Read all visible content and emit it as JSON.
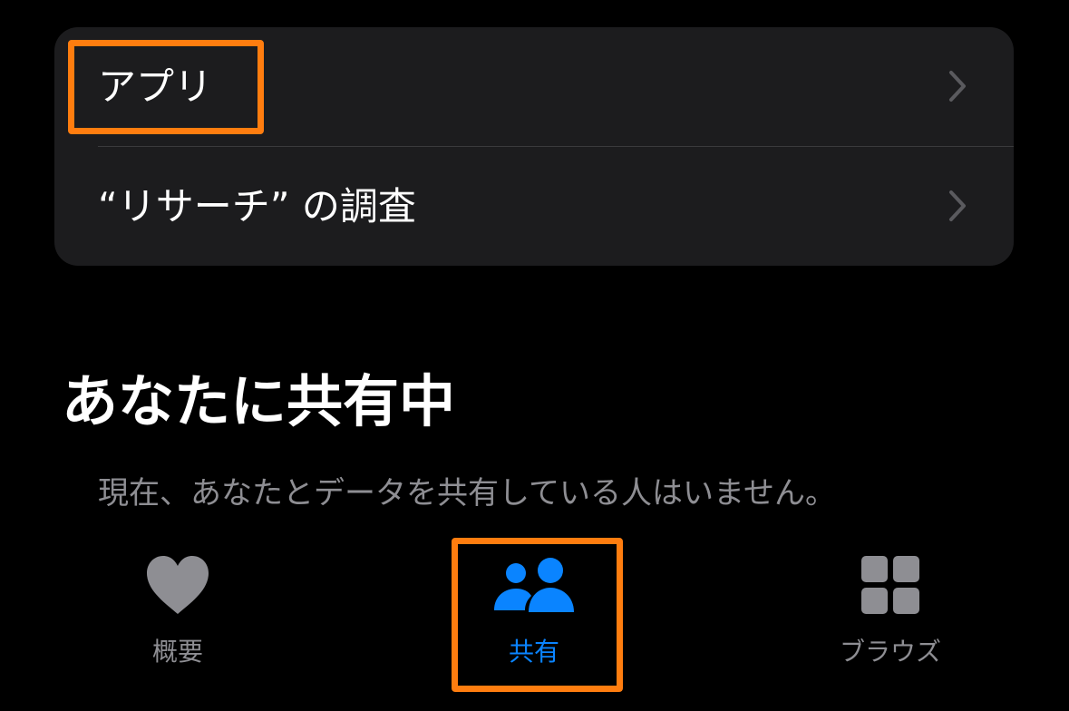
{
  "list": {
    "items": [
      {
        "label": "アプリ",
        "icon": "chevron-right-icon"
      },
      {
        "label": "“リサーチ” の調査",
        "icon": "chevron-right-icon"
      }
    ]
  },
  "sharing": {
    "title": "あなたに共有中",
    "empty_message": "現在、あなたとデータを共有している人はいません。"
  },
  "tab_bar": {
    "tabs": [
      {
        "label": "概要",
        "icon": "heart-icon",
        "active": false
      },
      {
        "label": "共有",
        "icon": "people-icon",
        "active": true
      },
      {
        "label": "ブラウズ",
        "icon": "grid-icon",
        "active": false
      }
    ]
  },
  "colors": {
    "background": "#000000",
    "card": "#1c1c1e",
    "accent": "#0a84ff",
    "inactive": "#8e8e93",
    "highlight": "#ff7d0f"
  }
}
